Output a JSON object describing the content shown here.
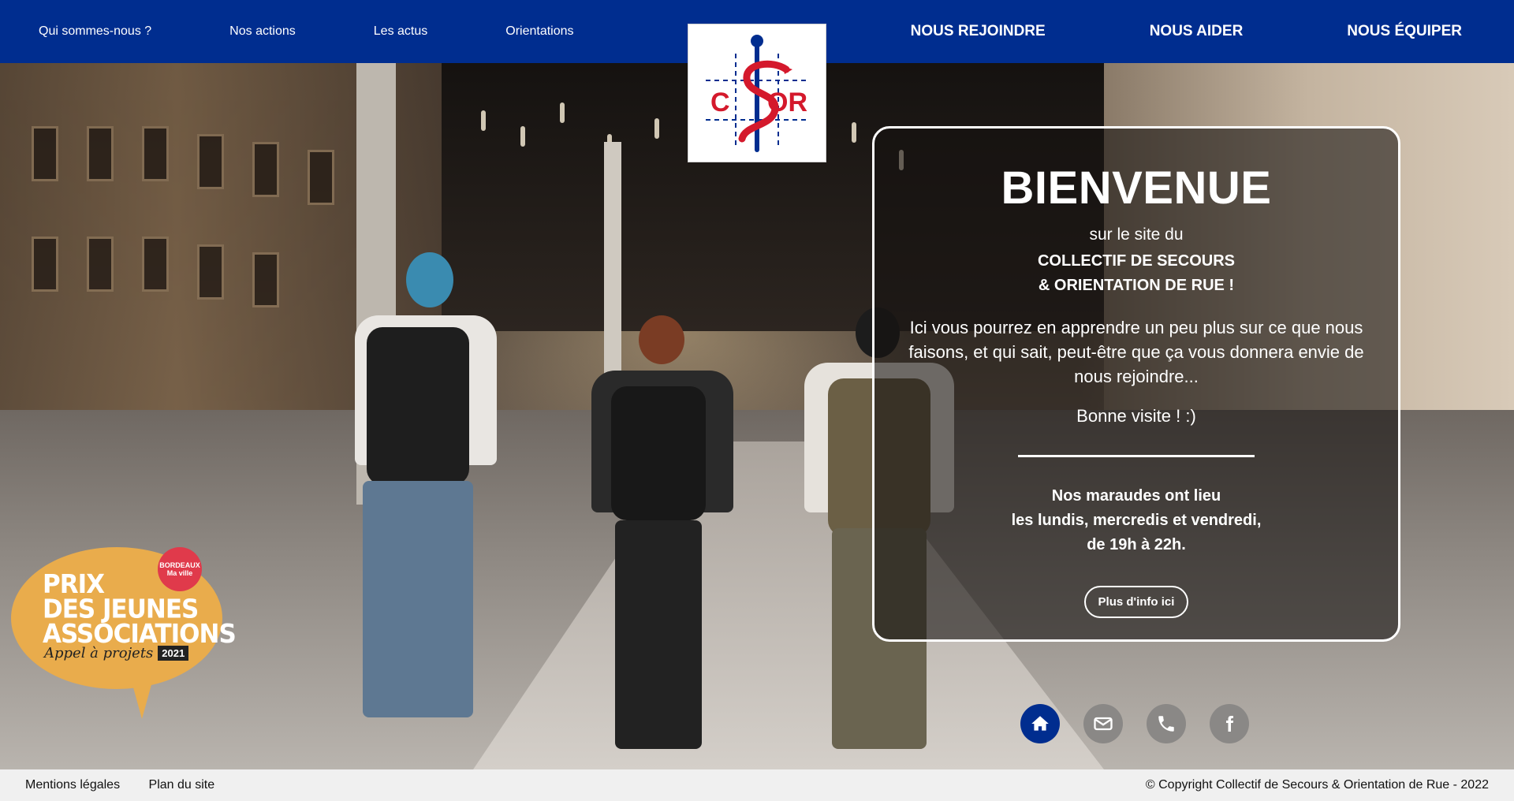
{
  "nav": {
    "left": [
      "Qui sommes-nous ?",
      "Nos actions",
      "Les actus",
      "Orientations"
    ],
    "right": [
      "NOUS REJOINDRE",
      "NOUS AIDER",
      "NOUS ÉQUIPER"
    ]
  },
  "logo": {
    "text": "CSOR",
    "colors": {
      "primary": "#002d8f",
      "accent": "#d4192c"
    }
  },
  "welcome": {
    "title": "BIENVENUE",
    "subtitle": "sur le site du",
    "org_line1": "COLLECTIF DE SECOURS",
    "org_line2": "& ORIENTATION DE RUE !",
    "intro": "Ici vous pourrez en apprendre un peu plus sur ce que nous faisons, et qui sait, peut-être que ça vous donnera envie de nous rejoindre...",
    "farewell": "Bonne visite ! :)",
    "schedule_line1": "Nos maraudes ont lieu",
    "schedule_line2": "les lundis, mercredis et vendredi,",
    "schedule_line3": "de 19h à 22h.",
    "more_button": "Plus d'info ici"
  },
  "award": {
    "line1": "PRIX",
    "line2": "DES JEUNES",
    "line3": "ASSOCIATIONS",
    "script": "Appel à projets",
    "year": "2021",
    "seal_line1": "BORDEAUX",
    "seal_line2": "Ma ville",
    "color": "#e9ac4c"
  },
  "socials": [
    {
      "icon": "home-icon",
      "active": true
    },
    {
      "icon": "mail-icon",
      "active": false
    },
    {
      "icon": "phone-icon",
      "active": false
    },
    {
      "icon": "facebook-icon",
      "active": false
    }
  ],
  "footer": {
    "legal": "Mentions légales",
    "sitemap": "Plan du site",
    "copyright": "© Copyright Collectif de Secours & Orientation de Rue - 2022"
  },
  "colors": {
    "nav_bg": "#002d8f",
    "footer_bg": "#f0f0f0"
  }
}
